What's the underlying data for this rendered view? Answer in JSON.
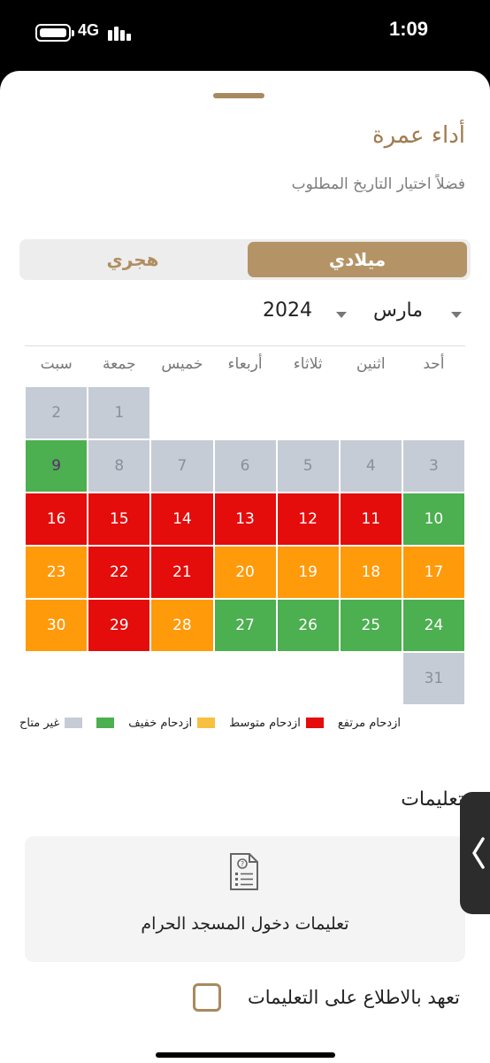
{
  "status": {
    "network": "4G",
    "time": "1:09"
  },
  "sheet": {
    "title": "أداء عمرة",
    "subtitle": "فضلاً اختيار التاريخ المطلوب"
  },
  "calendar_toggle": {
    "gregorian_label": "ميلادي",
    "hijri_label": "هجري",
    "selected": "ميلادي"
  },
  "selector": {
    "month": "مارس",
    "year": "2024"
  },
  "weekdays": [
    "أحد",
    "اثنين",
    "ثلاثاء",
    "أربعاء",
    "خميس",
    "جمعة",
    "سبت"
  ],
  "days": [
    {
      "label": "",
      "status": "empty"
    },
    {
      "label": "",
      "status": "empty"
    },
    {
      "label": "",
      "status": "empty"
    },
    {
      "label": "",
      "status": "empty"
    },
    {
      "label": "",
      "status": "empty"
    },
    {
      "label": "1",
      "status": "unavailable"
    },
    {
      "label": "2",
      "status": "unavailable"
    },
    {
      "label": "3",
      "status": "unavailable"
    },
    {
      "label": "4",
      "status": "unavailable"
    },
    {
      "label": "5",
      "status": "unavailable"
    },
    {
      "label": "6",
      "status": "unavailable"
    },
    {
      "label": "7",
      "status": "unavailable"
    },
    {
      "label": "8",
      "status": "unavailable"
    },
    {
      "label": "9",
      "status": "available"
    },
    {
      "label": "10",
      "status": "available"
    },
    {
      "label": "11",
      "status": "medium"
    },
    {
      "label": "12",
      "status": "medium"
    },
    {
      "label": "13",
      "status": "medium"
    },
    {
      "label": "14",
      "status": "medium"
    },
    {
      "label": "15",
      "status": "medium"
    },
    {
      "label": "16",
      "status": "medium"
    },
    {
      "label": "17",
      "status": "light"
    },
    {
      "label": "18",
      "status": "light"
    },
    {
      "label": "19",
      "status": "light"
    },
    {
      "label": "20",
      "status": "light"
    },
    {
      "label": "21",
      "status": "medium"
    },
    {
      "label": "22",
      "status": "medium"
    },
    {
      "label": "23",
      "status": "light"
    },
    {
      "label": "24",
      "status": "available"
    },
    {
      "label": "25",
      "status": "available"
    },
    {
      "label": "26",
      "status": "available"
    },
    {
      "label": "27",
      "status": "available"
    },
    {
      "label": "28",
      "status": "light"
    },
    {
      "label": "29",
      "status": "medium"
    },
    {
      "label": "30",
      "status": "light"
    },
    {
      "label": "31",
      "status": "unavailable"
    }
  ],
  "legend": [
    {
      "label": "غير متاح",
      "color": "#c6ccd6"
    },
    {
      "label": "",
      "color": "#4caf50"
    },
    {
      "label": "ازدحام خفيف",
      "color": "#f7c040"
    },
    {
      "label": "ازدحام متوسط",
      "color": "#e50c0c"
    },
    {
      "label": "ازدحام مرتفع",
      "color": ""
    }
  ],
  "instructions": {
    "title": "تعليمات",
    "card_text": "تعليمات دخول المسجد الحرام",
    "card_icon": "document-icon"
  },
  "agreement": {
    "label": "تعهد بالاطلاع على التعليمات",
    "checked": false
  },
  "colors": {
    "accent": "#b49466",
    "title": "#a07b4f",
    "unavailable": "#c6ccd6",
    "available": "#4caf50",
    "light": "#ff9a0a",
    "medium": "#e50c0c"
  }
}
